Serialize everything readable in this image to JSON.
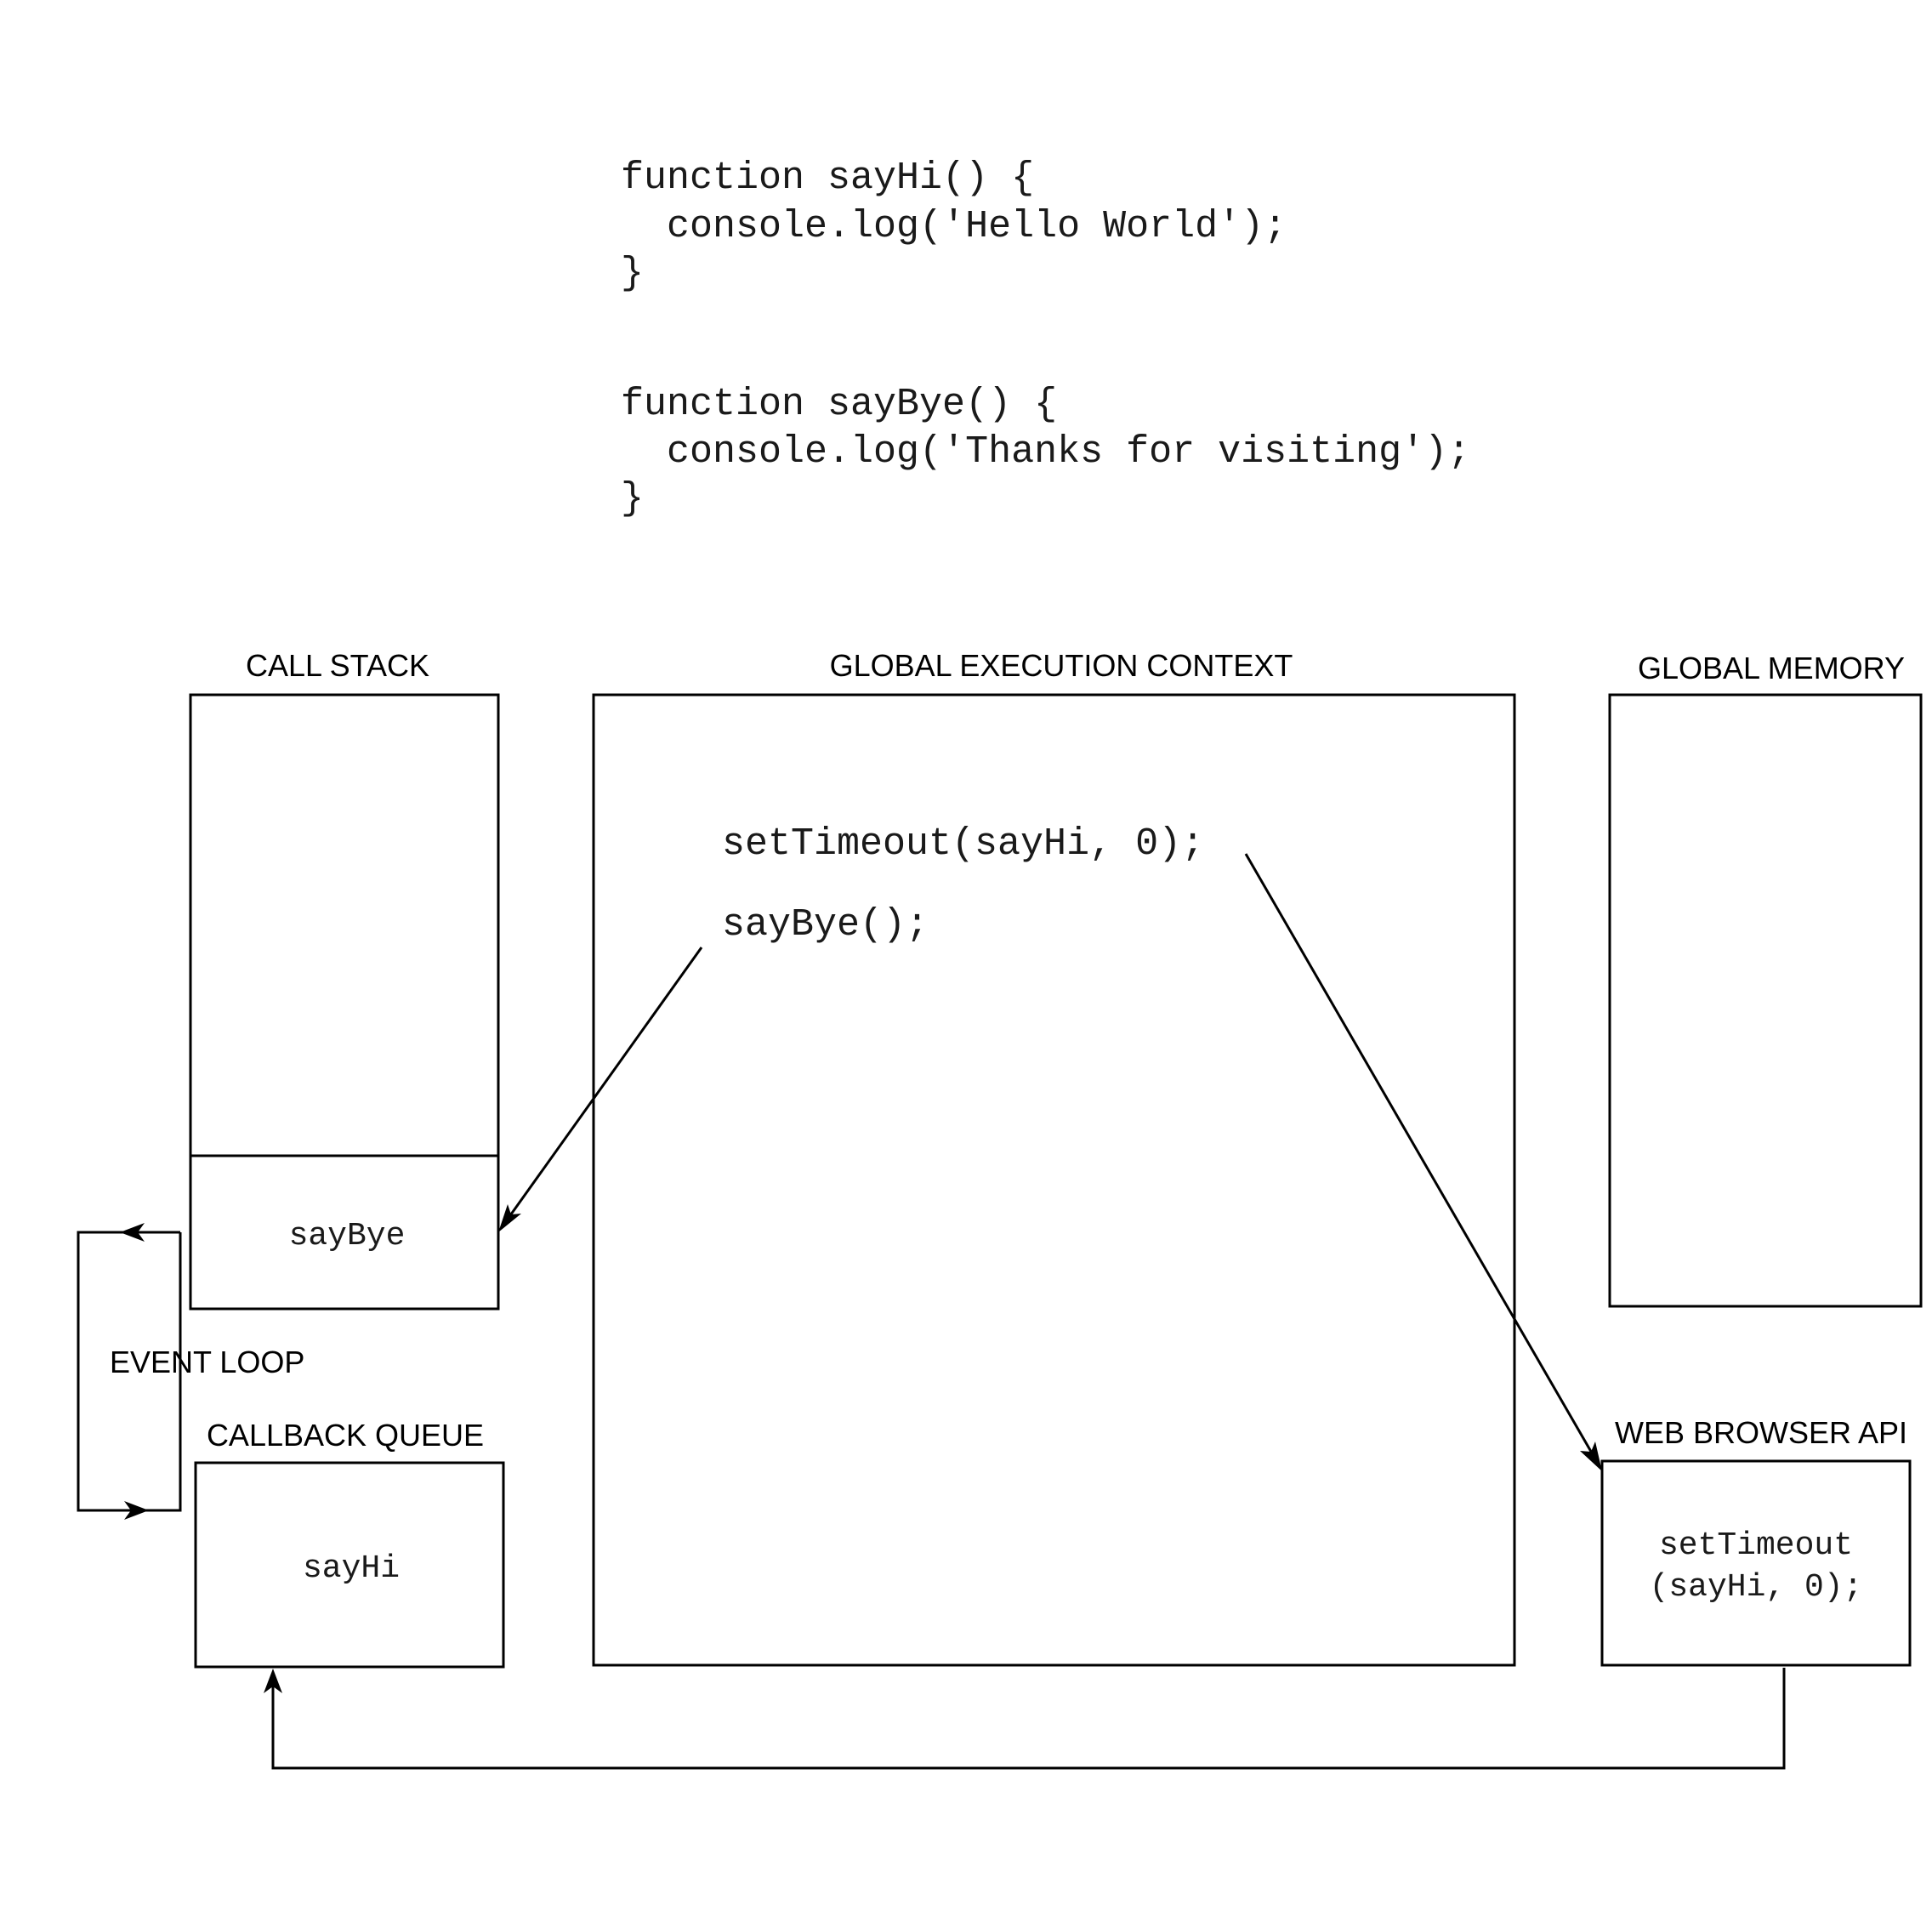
{
  "code_block": {
    "lines": [
      "function sayHi() {",
      "  console.log('Hello World');",
      "}",
      "",
      "",
      "function sayBye() {",
      "  console.log('Thanks for visiting');",
      "}"
    ]
  },
  "call_stack": {
    "title": "CALL STACK",
    "frame": "sayBye"
  },
  "global_execution_context": {
    "title": "GLOBAL EXECUTION CONTEXT",
    "statements": [
      "setTimeout(sayHi, 0);",
      "sayBye();"
    ]
  },
  "global_memory": {
    "title": "GLOBAL MEMORY"
  },
  "event_loop": {
    "label": "EVENT LOOP"
  },
  "callback_queue": {
    "title": "CALLBACK QUEUE",
    "item": "sayHi"
  },
  "web_browser_api": {
    "title": "WEB BROWSER API",
    "item_line1": "setTimeout",
    "item_line2": "(sayHi, 0);"
  }
}
